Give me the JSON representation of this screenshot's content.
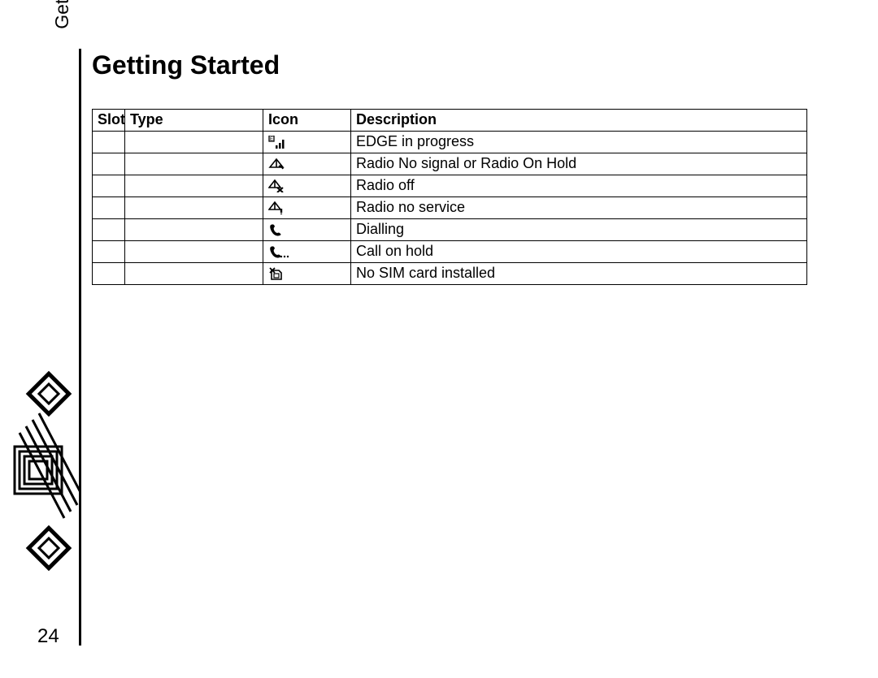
{
  "sidebar_label": "Getting Started",
  "heading": "Getting Started",
  "page_number": "24",
  "table": {
    "headers": [
      "Slot",
      "Type",
      "Icon",
      "Description"
    ],
    "rows": [
      {
        "slot": "",
        "type": "",
        "icon": "edge-progress-icon",
        "description": "EDGE in progress"
      },
      {
        "slot": "",
        "type": "",
        "icon": "radio-nosignal-icon",
        "description": "Radio No signal or Radio On Hold"
      },
      {
        "slot": "",
        "type": "",
        "icon": "radio-off-icon",
        "description": "Radio off"
      },
      {
        "slot": "",
        "type": "",
        "icon": "radio-noservice-icon",
        "description": "Radio no service"
      },
      {
        "slot": "",
        "type": "",
        "icon": "dialling-icon",
        "description": "Dialling"
      },
      {
        "slot": "",
        "type": "",
        "icon": "call-hold-icon",
        "description": "Call on hold"
      },
      {
        "slot": "",
        "type": "",
        "icon": "no-sim-icon",
        "description": "No SIM card installed"
      }
    ]
  }
}
